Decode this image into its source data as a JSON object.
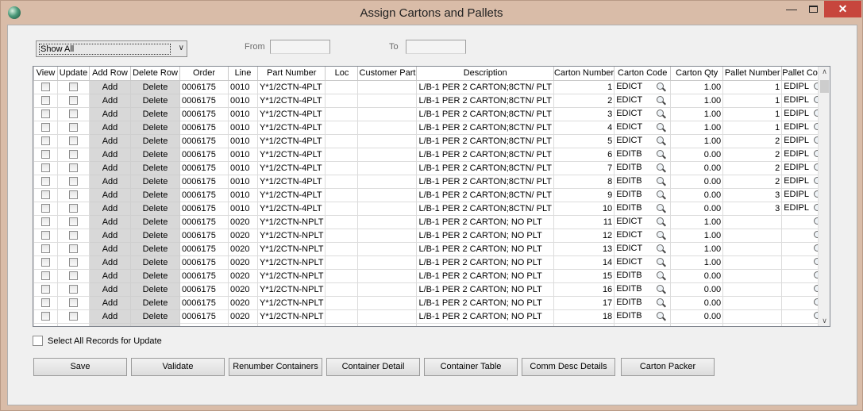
{
  "window": {
    "title": "Assign Cartons and Pallets",
    "controls": {
      "minimize": "—",
      "close": "✕"
    }
  },
  "filter": {
    "selected": "Show All",
    "from_label": "From",
    "to_label": "To",
    "from_value": "",
    "to_value": ""
  },
  "grid": {
    "columns": [
      "View",
      "Update",
      "Add Row",
      "Delete Row",
      "Order",
      "Line",
      "Part Number",
      "Loc",
      "Customer Part",
      "Description",
      "Carton Number",
      "Carton Code",
      "Carton Qty",
      "Pallet Number",
      "Pallet Code"
    ],
    "add_label": "Add",
    "delete_label": "Delete",
    "rows": [
      {
        "order": "0006175",
        "line": "0010",
        "part": "Y*1/2CTN-4PLT",
        "loc": "",
        "cust": "",
        "desc": "L/B-1 PER 2 CARTON;8CTN/ PLT",
        "carton_no": "1",
        "carton_code": "EDICT",
        "qty": "1.00",
        "pallet_no": "1",
        "pallet_code": "EDIPL"
      },
      {
        "order": "0006175",
        "line": "0010",
        "part": "Y*1/2CTN-4PLT",
        "loc": "",
        "cust": "",
        "desc": "L/B-1 PER 2 CARTON;8CTN/ PLT",
        "carton_no": "2",
        "carton_code": "EDICT",
        "qty": "1.00",
        "pallet_no": "1",
        "pallet_code": "EDIPL"
      },
      {
        "order": "0006175",
        "line": "0010",
        "part": "Y*1/2CTN-4PLT",
        "loc": "",
        "cust": "",
        "desc": "L/B-1 PER 2 CARTON;8CTN/ PLT",
        "carton_no": "3",
        "carton_code": "EDICT",
        "qty": "1.00",
        "pallet_no": "1",
        "pallet_code": "EDIPL"
      },
      {
        "order": "0006175",
        "line": "0010",
        "part": "Y*1/2CTN-4PLT",
        "loc": "",
        "cust": "",
        "desc": "L/B-1 PER 2 CARTON;8CTN/ PLT",
        "carton_no": "4",
        "carton_code": "EDICT",
        "qty": "1.00",
        "pallet_no": "1",
        "pallet_code": "EDIPL"
      },
      {
        "order": "0006175",
        "line": "0010",
        "part": "Y*1/2CTN-4PLT",
        "loc": "",
        "cust": "",
        "desc": "L/B-1 PER 2 CARTON;8CTN/ PLT",
        "carton_no": "5",
        "carton_code": "EDICT",
        "qty": "1.00",
        "pallet_no": "2",
        "pallet_code": "EDIPL"
      },
      {
        "order": "0006175",
        "line": "0010",
        "part": "Y*1/2CTN-4PLT",
        "loc": "",
        "cust": "",
        "desc": "L/B-1 PER 2 CARTON;8CTN/ PLT",
        "carton_no": "6",
        "carton_code": "EDITB",
        "qty": "0.00",
        "pallet_no": "2",
        "pallet_code": "EDIPL"
      },
      {
        "order": "0006175",
        "line": "0010",
        "part": "Y*1/2CTN-4PLT",
        "loc": "",
        "cust": "",
        "desc": "L/B-1 PER 2 CARTON;8CTN/ PLT",
        "carton_no": "7",
        "carton_code": "EDITB",
        "qty": "0.00",
        "pallet_no": "2",
        "pallet_code": "EDIPL"
      },
      {
        "order": "0006175",
        "line": "0010",
        "part": "Y*1/2CTN-4PLT",
        "loc": "",
        "cust": "",
        "desc": "L/B-1 PER 2 CARTON;8CTN/ PLT",
        "carton_no": "8",
        "carton_code": "EDITB",
        "qty": "0.00",
        "pallet_no": "2",
        "pallet_code": "EDIPL"
      },
      {
        "order": "0006175",
        "line": "0010",
        "part": "Y*1/2CTN-4PLT",
        "loc": "",
        "cust": "",
        "desc": "L/B-1 PER 2 CARTON;8CTN/ PLT",
        "carton_no": "9",
        "carton_code": "EDITB",
        "qty": "0.00",
        "pallet_no": "3",
        "pallet_code": "EDIPL"
      },
      {
        "order": "0006175",
        "line": "0010",
        "part": "Y*1/2CTN-4PLT",
        "loc": "",
        "cust": "",
        "desc": "L/B-1 PER 2 CARTON;8CTN/ PLT",
        "carton_no": "10",
        "carton_code": "EDITB",
        "qty": "0.00",
        "pallet_no": "3",
        "pallet_code": "EDIPL"
      },
      {
        "order": "0006175",
        "line": "0020",
        "part": "Y*1/2CTN-NPLT",
        "loc": "",
        "cust": "",
        "desc": "L/B-1 PER 2 CARTON; NO PLT",
        "carton_no": "11",
        "carton_code": "EDICT",
        "qty": "1.00",
        "pallet_no": "",
        "pallet_code": ""
      },
      {
        "order": "0006175",
        "line": "0020",
        "part": "Y*1/2CTN-NPLT",
        "loc": "",
        "cust": "",
        "desc": "L/B-1 PER 2 CARTON; NO PLT",
        "carton_no": "12",
        "carton_code": "EDICT",
        "qty": "1.00",
        "pallet_no": "",
        "pallet_code": ""
      },
      {
        "order": "0006175",
        "line": "0020",
        "part": "Y*1/2CTN-NPLT",
        "loc": "",
        "cust": "",
        "desc": "L/B-1 PER 2 CARTON; NO PLT",
        "carton_no": "13",
        "carton_code": "EDICT",
        "qty": "1.00",
        "pallet_no": "",
        "pallet_code": ""
      },
      {
        "order": "0006175",
        "line": "0020",
        "part": "Y*1/2CTN-NPLT",
        "loc": "",
        "cust": "",
        "desc": "L/B-1 PER 2 CARTON; NO PLT",
        "carton_no": "14",
        "carton_code": "EDICT",
        "qty": "1.00",
        "pallet_no": "",
        "pallet_code": ""
      },
      {
        "order": "0006175",
        "line": "0020",
        "part": "Y*1/2CTN-NPLT",
        "loc": "",
        "cust": "",
        "desc": "L/B-1 PER 2 CARTON; NO PLT",
        "carton_no": "15",
        "carton_code": "EDITB",
        "qty": "0.00",
        "pallet_no": "",
        "pallet_code": ""
      },
      {
        "order": "0006175",
        "line": "0020",
        "part": "Y*1/2CTN-NPLT",
        "loc": "",
        "cust": "",
        "desc": "L/B-1 PER 2 CARTON; NO PLT",
        "carton_no": "16",
        "carton_code": "EDITB",
        "qty": "0.00",
        "pallet_no": "",
        "pallet_code": ""
      },
      {
        "order": "0006175",
        "line": "0020",
        "part": "Y*1/2CTN-NPLT",
        "loc": "",
        "cust": "",
        "desc": "L/B-1 PER 2 CARTON; NO PLT",
        "carton_no": "17",
        "carton_code": "EDITB",
        "qty": "0.00",
        "pallet_no": "",
        "pallet_code": ""
      },
      {
        "order": "0006175",
        "line": "0020",
        "part": "Y*1/2CTN-NPLT",
        "loc": "",
        "cust": "",
        "desc": "L/B-1 PER 2 CARTON; NO PLT",
        "carton_no": "18",
        "carton_code": "EDITB",
        "qty": "0.00",
        "pallet_no": "",
        "pallet_code": ""
      }
    ]
  },
  "select_all_label": "Select All Records for Update",
  "buttons": [
    "Save",
    "Validate",
    "Renumber Containers",
    "Container Detail",
    "Container Table",
    "Comm Desc Details",
    "Carton Packer"
  ],
  "colors": {
    "title_bar": "#d9bca8",
    "close_button": "#c7463d",
    "cell_button": "#d8d8d8"
  },
  "icons": {
    "app": "app-globe-icon",
    "lookup": "magnifier-icon"
  }
}
